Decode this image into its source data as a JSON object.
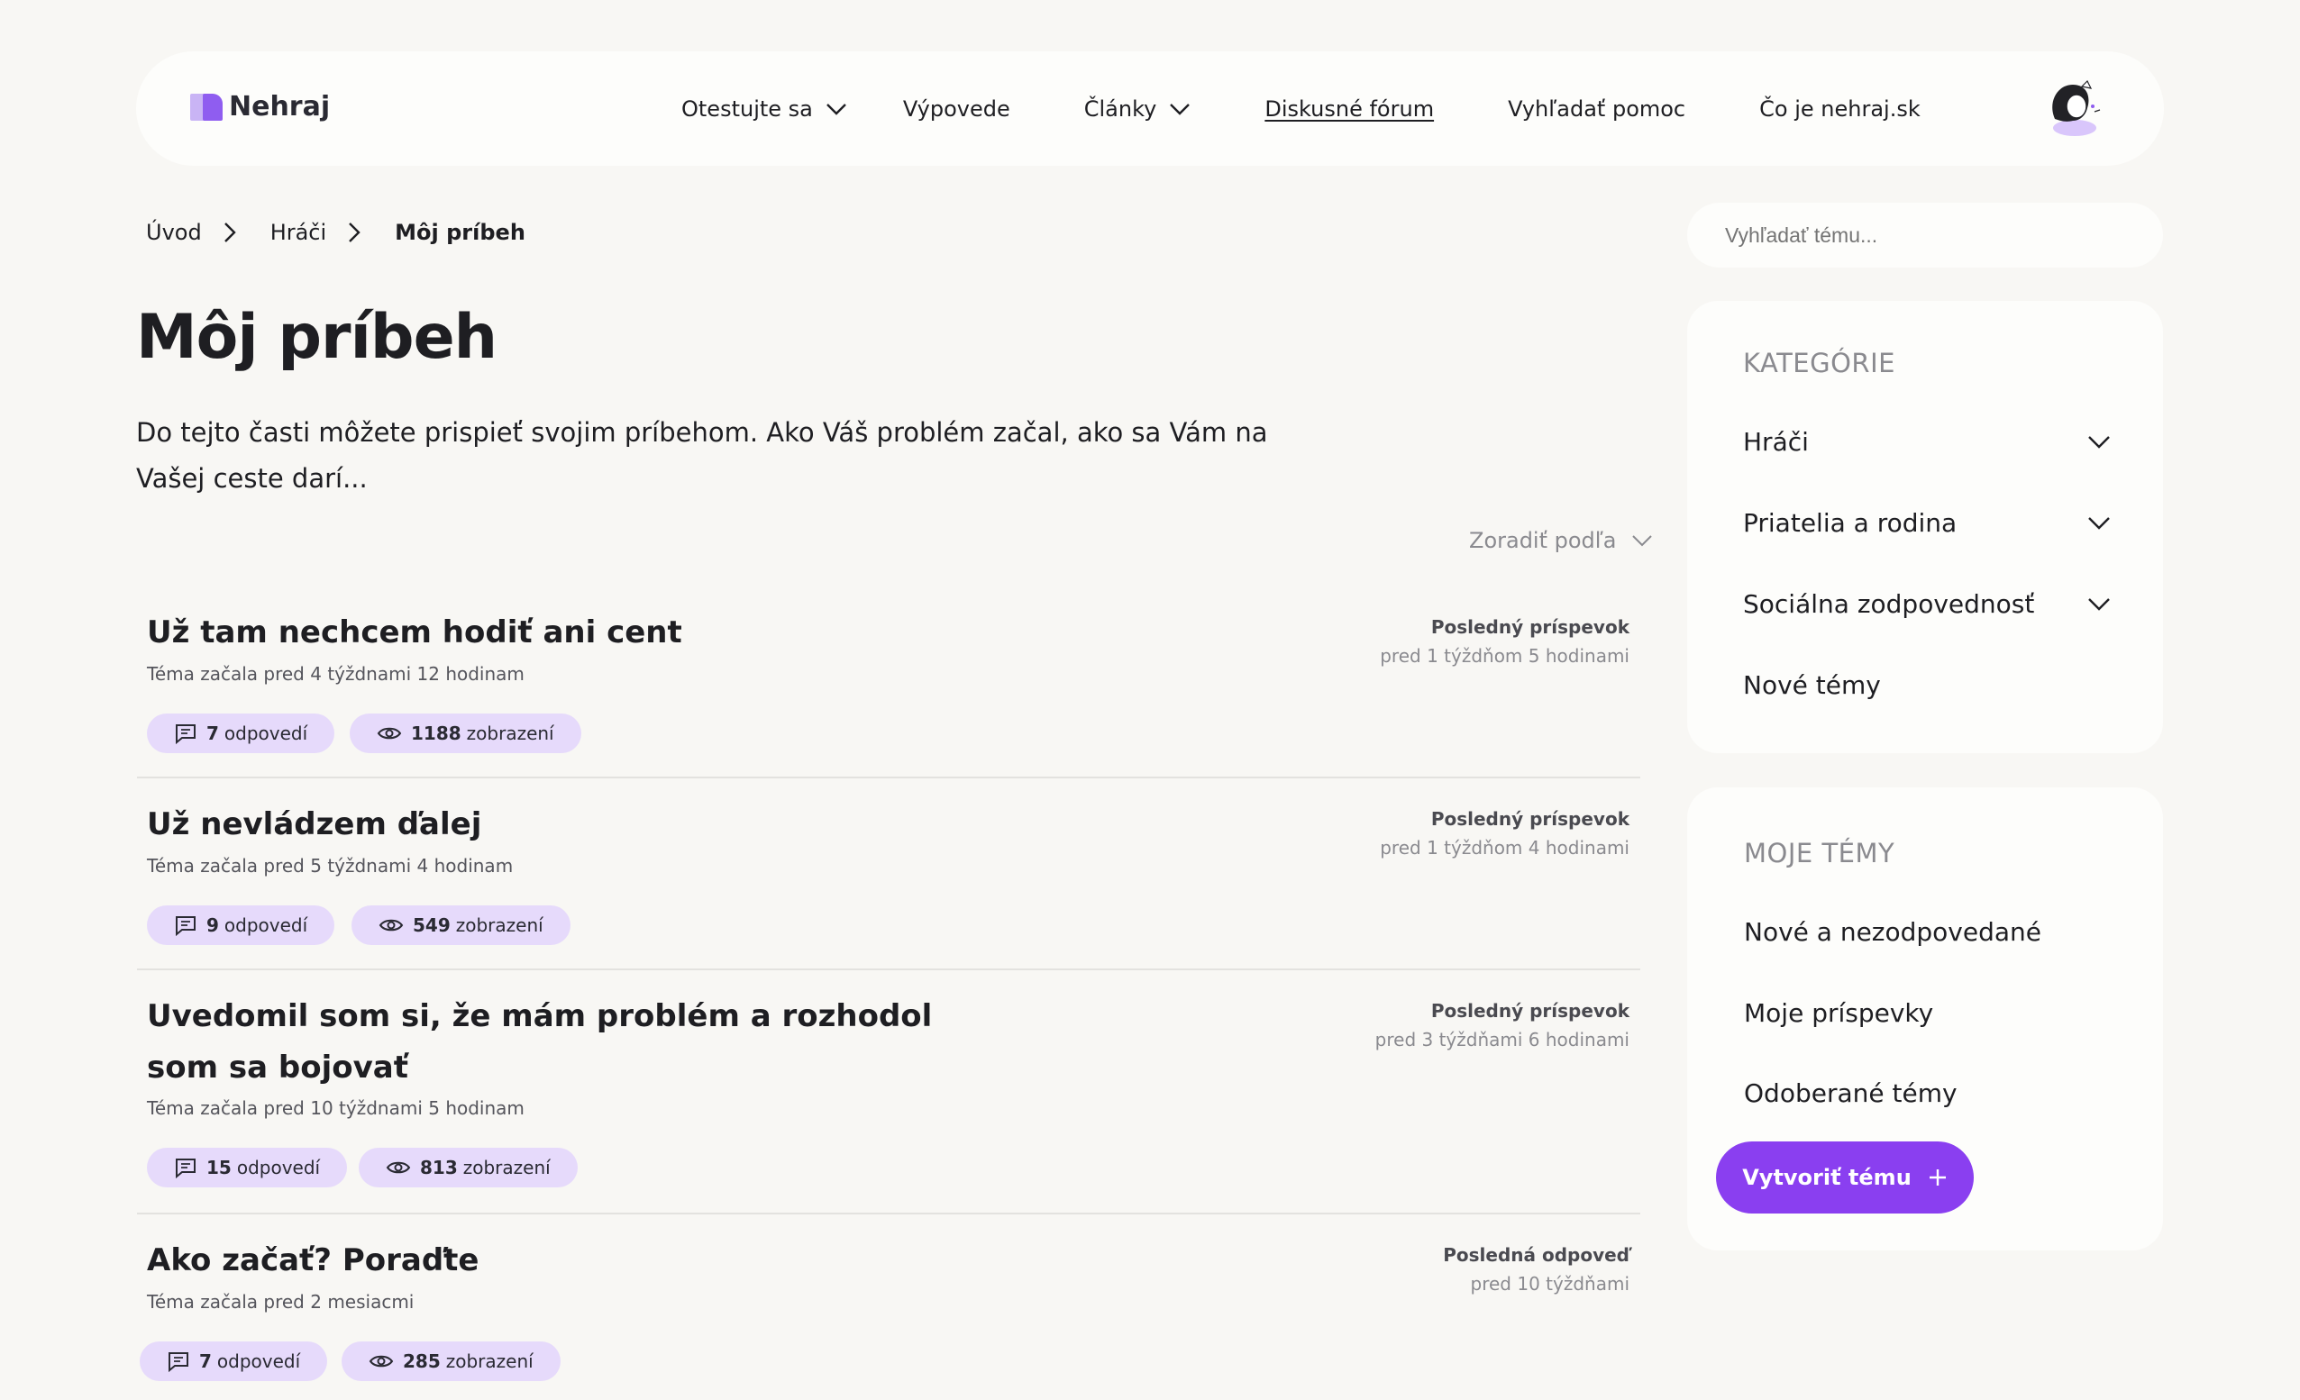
{
  "header": {
    "logo_text": "Nehraj",
    "nav": [
      {
        "label": "Otestujte sa",
        "dropdown": true
      },
      {
        "label": "Výpovede",
        "dropdown": false
      },
      {
        "label": "Články",
        "dropdown": true
      },
      {
        "label": "Diskusné fórum",
        "dropdown": false,
        "active": true
      },
      {
        "label": "Vyhľadať pomoc",
        "dropdown": false
      },
      {
        "label": "Čo je nehraj.sk",
        "dropdown": false
      }
    ]
  },
  "breadcrumb": [
    "Úvod",
    "Hráči",
    "Môj príbeh"
  ],
  "page": {
    "title": "Môj príbeh",
    "intro": "Do tejto časti môžete prispieť svojim príbehom.  Ako Váš problém začal, ako sa Vám na Vašej ceste darí...",
    "sort_label": "Zoradiť podľa"
  },
  "topics": [
    {
      "title": "Už tam nechcem hodiť ani cent",
      "started": "Téma začala pred 4 týždnami 12 hodinam",
      "last_label": "Posledný príspevok",
      "last_time": "pred 1 týždňom 5 hodinami",
      "replies": "7",
      "replies_label": "odpovedí",
      "views": "1188",
      "views_label": "zobrazení"
    },
    {
      "title": "Už nevládzem ďalej",
      "started": "Téma začala pred 5 týždnami 4 hodinam",
      "last_label": "Posledný príspevok",
      "last_time": "pred 1 týždňom 4 hodinami",
      "replies": "9",
      "replies_label": "odpovedí",
      "views": "549",
      "views_label": "zobrazení"
    },
    {
      "title_line1": "Uvedomil som si, že mám problém a rozhodol",
      "title_line2": "som sa bojovať",
      "started": "Téma začala pred 10 týždnami 5 hodinam",
      "last_label": "Posledný príspevok",
      "last_time": "pred 3 týždňami 6 hodinami",
      "replies": "15",
      "replies_label": "odpovedí",
      "views": "813",
      "views_label": "zobrazení"
    },
    {
      "title": "Ako začať? Poraďte",
      "started": "Téma začala pred 2 mesiacmi",
      "last_label": "Posledná odpoveď",
      "last_time": "pred 10 týždňami",
      "replies": "7",
      "replies_label": "odpovedí",
      "views": "285",
      "views_label": "zobrazení"
    }
  ],
  "sidebar": {
    "search_placeholder": "Vyhľadať tému...",
    "categories": {
      "heading": "KATEGÓRIE",
      "items": [
        "Hráči",
        "Priatelia a rodina",
        "Sociálna zodpovednosť",
        "Nové témy"
      ]
    },
    "my_topics": {
      "heading": "MOJE TÉMY",
      "items": [
        "Nové a nezodpovedané",
        "Moje príspevky",
        "Odoberané témy"
      ],
      "create_label": "Vytvoriť tému"
    }
  },
  "colors": {
    "background": "#f8f7f4",
    "accent": "#8a3ff0",
    "pill": "#e6dafb"
  }
}
